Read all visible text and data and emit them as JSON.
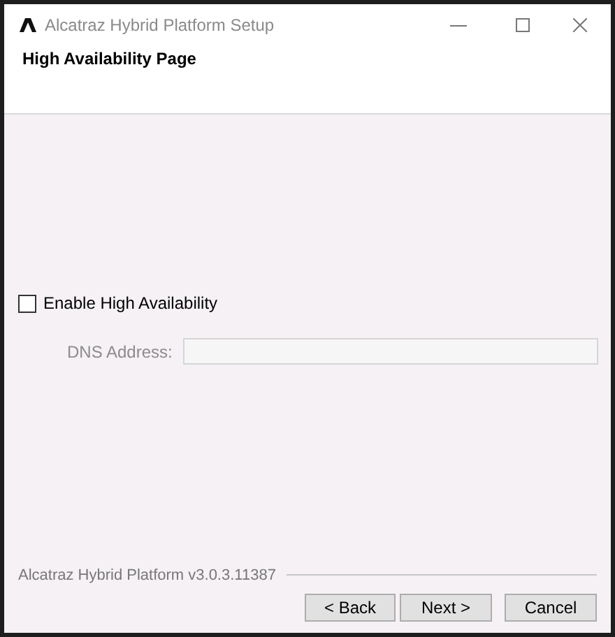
{
  "window": {
    "title": "Alcatraz Hybrid Platform Setup"
  },
  "page": {
    "title": "High Availability Page"
  },
  "options": [
    {
      "label": "Enable High Availability",
      "checked": false
    }
  ],
  "dns": {
    "label": "DNS Address:",
    "disabled": true
  },
  "footer": {
    "version": "Alcatraz Hybrid Platform v3.0.3.11387"
  },
  "buttons": [
    {
      "label": "< Back"
    },
    {
      "label": "Next >"
    },
    {
      "label": "Cancel"
    }
  ]
}
